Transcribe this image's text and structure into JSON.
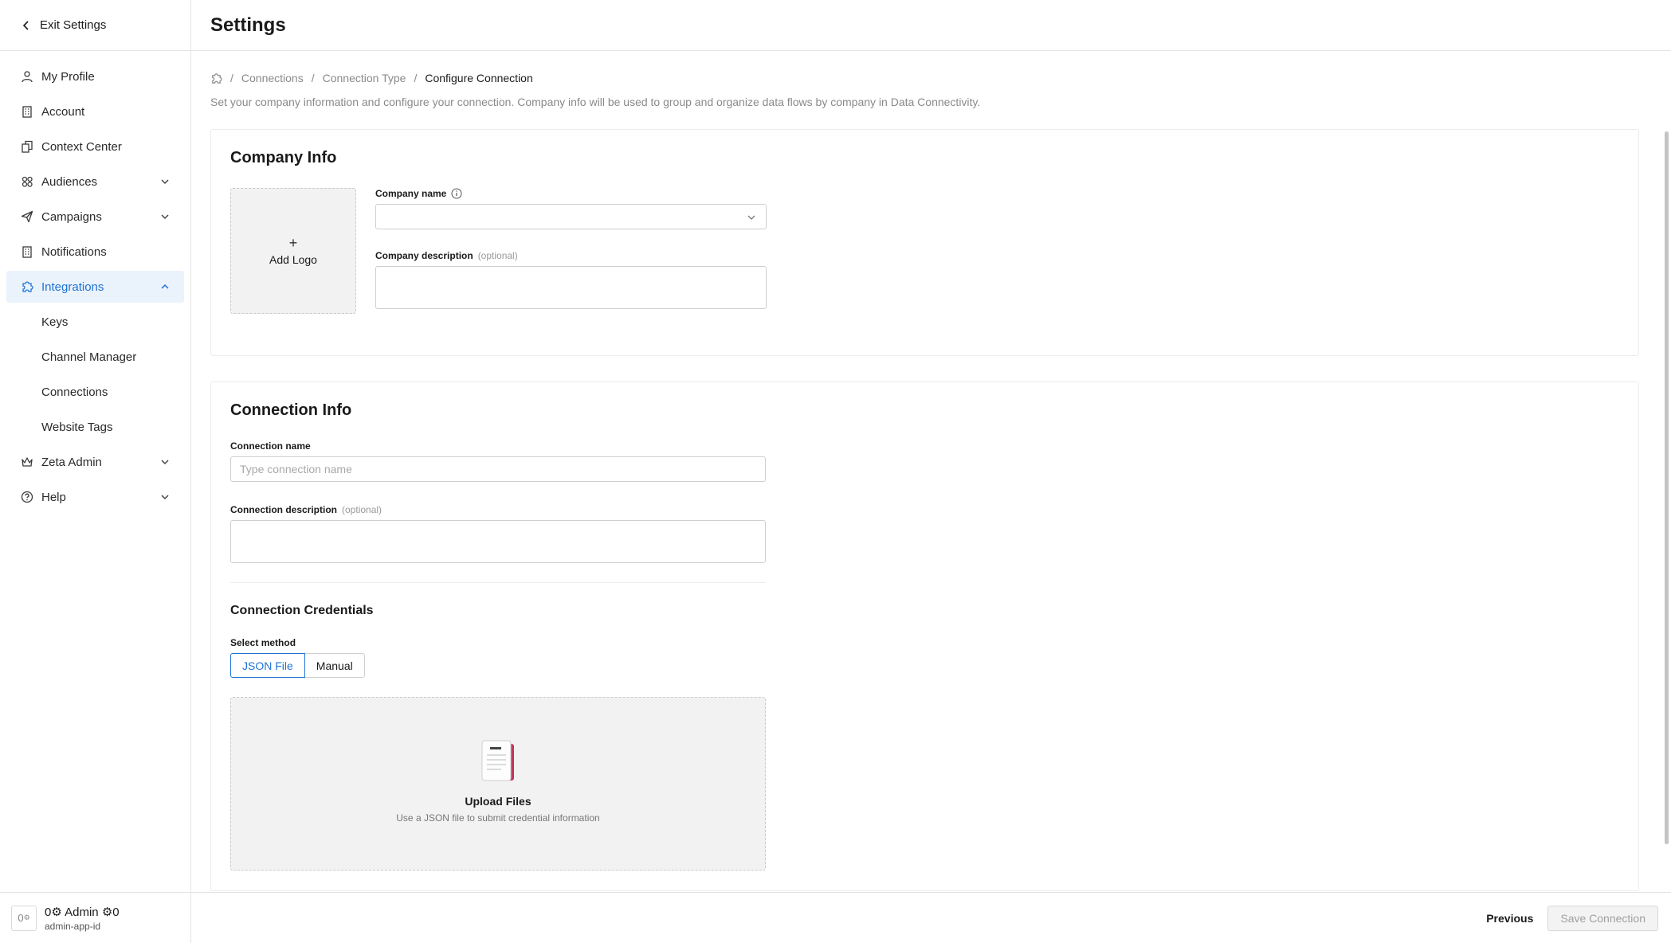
{
  "sidebar": {
    "exit_label": "Exit Settings",
    "items": [
      {
        "label": "My Profile",
        "icon": "user-icon"
      },
      {
        "label": "Account",
        "icon": "building-icon"
      },
      {
        "label": "Context Center",
        "icon": "documents-icon"
      },
      {
        "label": "Audiences",
        "icon": "audience-icon"
      },
      {
        "label": "Campaigns",
        "icon": "send-icon"
      },
      {
        "label": "Notifications",
        "icon": "building-icon"
      },
      {
        "label": "Integrations",
        "icon": "puzzle-icon"
      }
    ],
    "subitems": [
      "Keys",
      "Channel Manager",
      "Connections",
      "Website Tags"
    ],
    "bottom_items": [
      {
        "label": "Zeta Admin",
        "icon": "crown-icon"
      },
      {
        "label": "Help",
        "icon": "help-icon"
      }
    ],
    "user": {
      "avatar_text": "0",
      "name": "0⚙ Admin ⚙0",
      "id": "admin-app-id"
    }
  },
  "header": {
    "title": "Settings"
  },
  "breadcrumb": {
    "items": [
      "Connections",
      "Connection Type"
    ],
    "current": "Configure Connection",
    "separator": "/"
  },
  "description": "Set your company information and configure your connection. Company info will be used to group and organize data flows by company in Data Connectivity.",
  "company_info": {
    "title": "Company Info",
    "add_logo": "Add Logo",
    "plus": "+",
    "company_name_label": "Company name",
    "company_description_label": "Company description",
    "optional": "(optional)"
  },
  "connection_info": {
    "title": "Connection Info",
    "name_label": "Connection name",
    "name_placeholder": "Type connection name",
    "description_label": "Connection description",
    "optional": "(optional)",
    "credentials_title": "Connection Credentials",
    "method_label": "Select method",
    "methods": [
      "JSON File",
      "Manual"
    ],
    "upload_title": "Upload Files",
    "upload_hint": "Use a JSON file to submit credential information"
  },
  "footer": {
    "previous": "Previous",
    "save": "Save Connection"
  },
  "colors": {
    "accent": "#1f73d4",
    "active_bg": "#eaf2fc",
    "upload_bg": "#f2f2f2"
  }
}
